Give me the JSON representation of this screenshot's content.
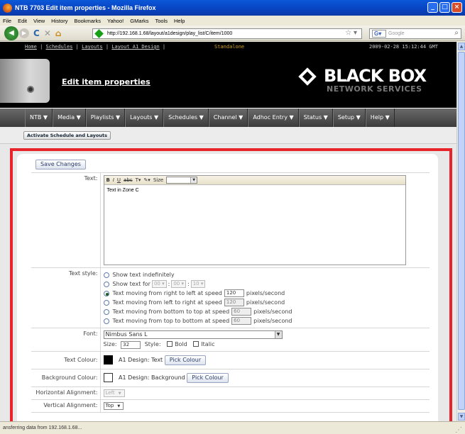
{
  "window": {
    "title": "NTB 7703 Edit item properties - Mozilla Firefox",
    "controls": {
      "minimize": "_",
      "maximize": "□",
      "close": "×"
    }
  },
  "menubar": [
    "File",
    "Edit",
    "View",
    "History",
    "Bookmarks",
    "Yahoo!",
    "GMarks",
    "Tools",
    "Help"
  ],
  "navbar": {
    "url": "http://192.168.1.68/layout/a1design/play_list/C/item/1000",
    "search_engine": "G",
    "search_placeholder": "Google"
  },
  "header": {
    "links": [
      "Home",
      "Schedules",
      "Layouts",
      "Layout A1 Design"
    ],
    "standalone": "Standalone",
    "datetime": "2009-02-28 15:12:44 GMT",
    "page_title": "Edit item properties",
    "logo_main": "BLACK BOX",
    "logo_sub": "NETWORK SERVICES"
  },
  "mainnav": [
    "NTB ▼",
    "Media ▼",
    "Playlists ▼",
    "Layouts ▼",
    "Schedules ▼",
    "Channel ▼",
    "Adhoc Entry ▼",
    "Status ▼",
    "Setup ▼",
    "Help ▼"
  ],
  "activate_button": "Activate Schedule and Layouts",
  "form": {
    "save_label": "Save Changes",
    "text_label": "Text:",
    "editor_size_label": "Size",
    "editor_content": "Text in Zone C",
    "text_style_label": "Text style:",
    "styles": {
      "indefinite": "Show text indefinitely",
      "for_label": "Show text for",
      "for_h": "00",
      "for_m": "00",
      "for_s": "10",
      "rtl": "Text moving from right to left at speed",
      "rtl_speed": "120",
      "ltr": "Text moving from left to right at speed",
      "ltr_speed": "120",
      "btt": "Text moving from bottom to top at speed",
      "btt_speed": "60",
      "ttb": "Text moving from top to bottom at speed",
      "ttb_speed": "60",
      "unit": "pixels/second",
      "selected": "rtl"
    },
    "font_label": "Font:",
    "font_value": "Nimbus Sans L",
    "size_label": "Size:",
    "size_value": "32",
    "style_label": "Style:",
    "bold_label": "Bold",
    "italic_label": "Italic",
    "text_colour_label": "Text Colour:",
    "text_colour_value": "A1 Design: Text",
    "text_colour_swatch": "#000000",
    "pick_colour": "Pick Colour",
    "bg_colour_label": "Background Colour:",
    "bg_colour_value": "A1 Design: Background",
    "bg_colour_swatch": "#ffffff",
    "halign_label": "Horizontal Alignment:",
    "halign_value": "Left",
    "valign_label": "Vertical Alignment:",
    "valign_value": "Top"
  },
  "status": "ansferring data from 192.168.1.68...",
  "colors": {
    "accent_red": "#e8232a",
    "header_bg": "#000000",
    "nav_bg": "#4a4a4a"
  }
}
